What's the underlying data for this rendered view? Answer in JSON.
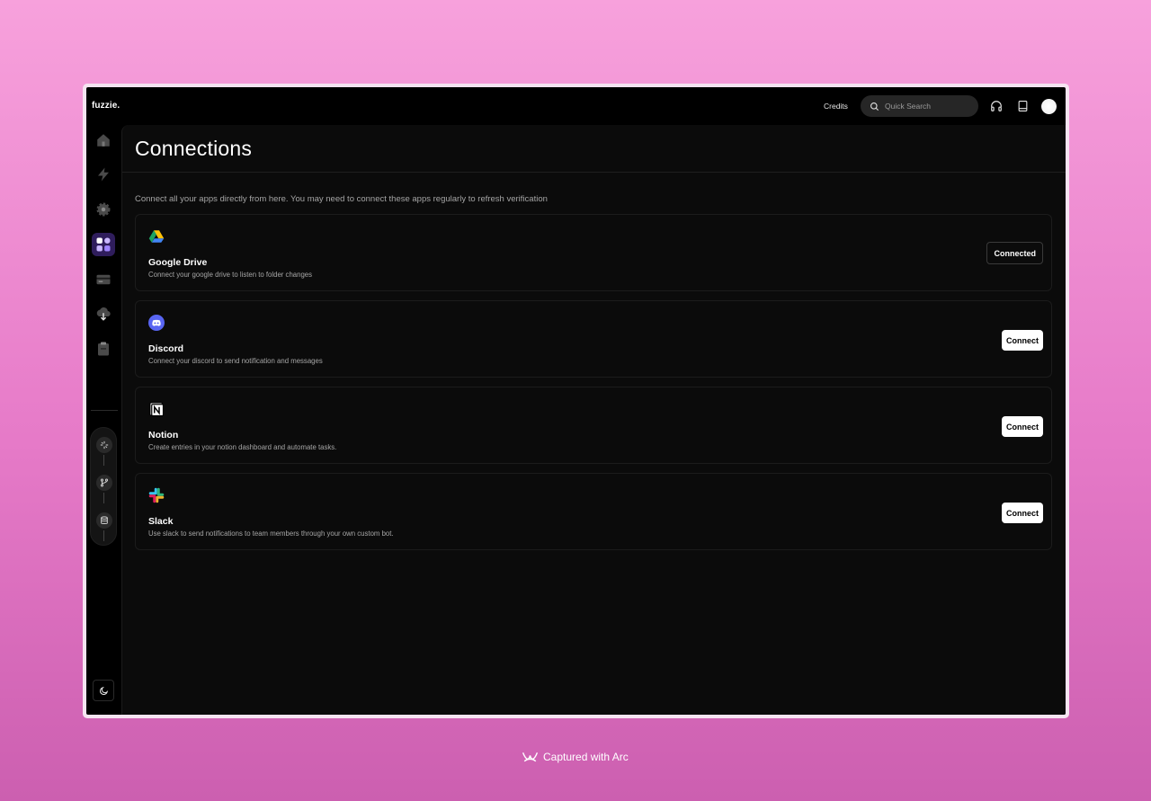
{
  "app": {
    "logo": "fuzzie."
  },
  "topbar": {
    "credits": "Credits",
    "search_placeholder": "Quick Search",
    "icons": [
      "headphones-icon",
      "book-icon"
    ]
  },
  "sidebar": {
    "items": [
      "home",
      "workflows",
      "settings",
      "connections",
      "billing",
      "templates",
      "logs"
    ],
    "active": "connections",
    "steps": [
      "sparkle",
      "branch",
      "database"
    ]
  },
  "page": {
    "title": "Connections",
    "subtitle": "Connect all your apps directly from here. You may need to connect these apps regularly to refresh verification"
  },
  "connections": [
    {
      "name": "Google Drive",
      "description": "Connect your google drive to listen to folder changes",
      "button": "Connected",
      "connected": true,
      "icon": "google-drive-icon"
    },
    {
      "name": "Discord",
      "description": "Connect your discord to send notification and messages",
      "button": "Connect",
      "connected": false,
      "icon": "discord-icon"
    },
    {
      "name": "Notion",
      "description": "Create entries in your notion dashboard and automate tasks.",
      "button": "Connect",
      "connected": false,
      "icon": "notion-icon"
    },
    {
      "name": "Slack",
      "description": "Use slack to send notifications to team members through your own custom bot.",
      "button": "Connect",
      "connected": false,
      "icon": "slack-icon"
    }
  ],
  "watermark": "Captured with Arc",
  "colors": {
    "accent": "#2f1d5c",
    "background_top": "#f7a1dc",
    "background_bottom": "#cc5fb0"
  }
}
